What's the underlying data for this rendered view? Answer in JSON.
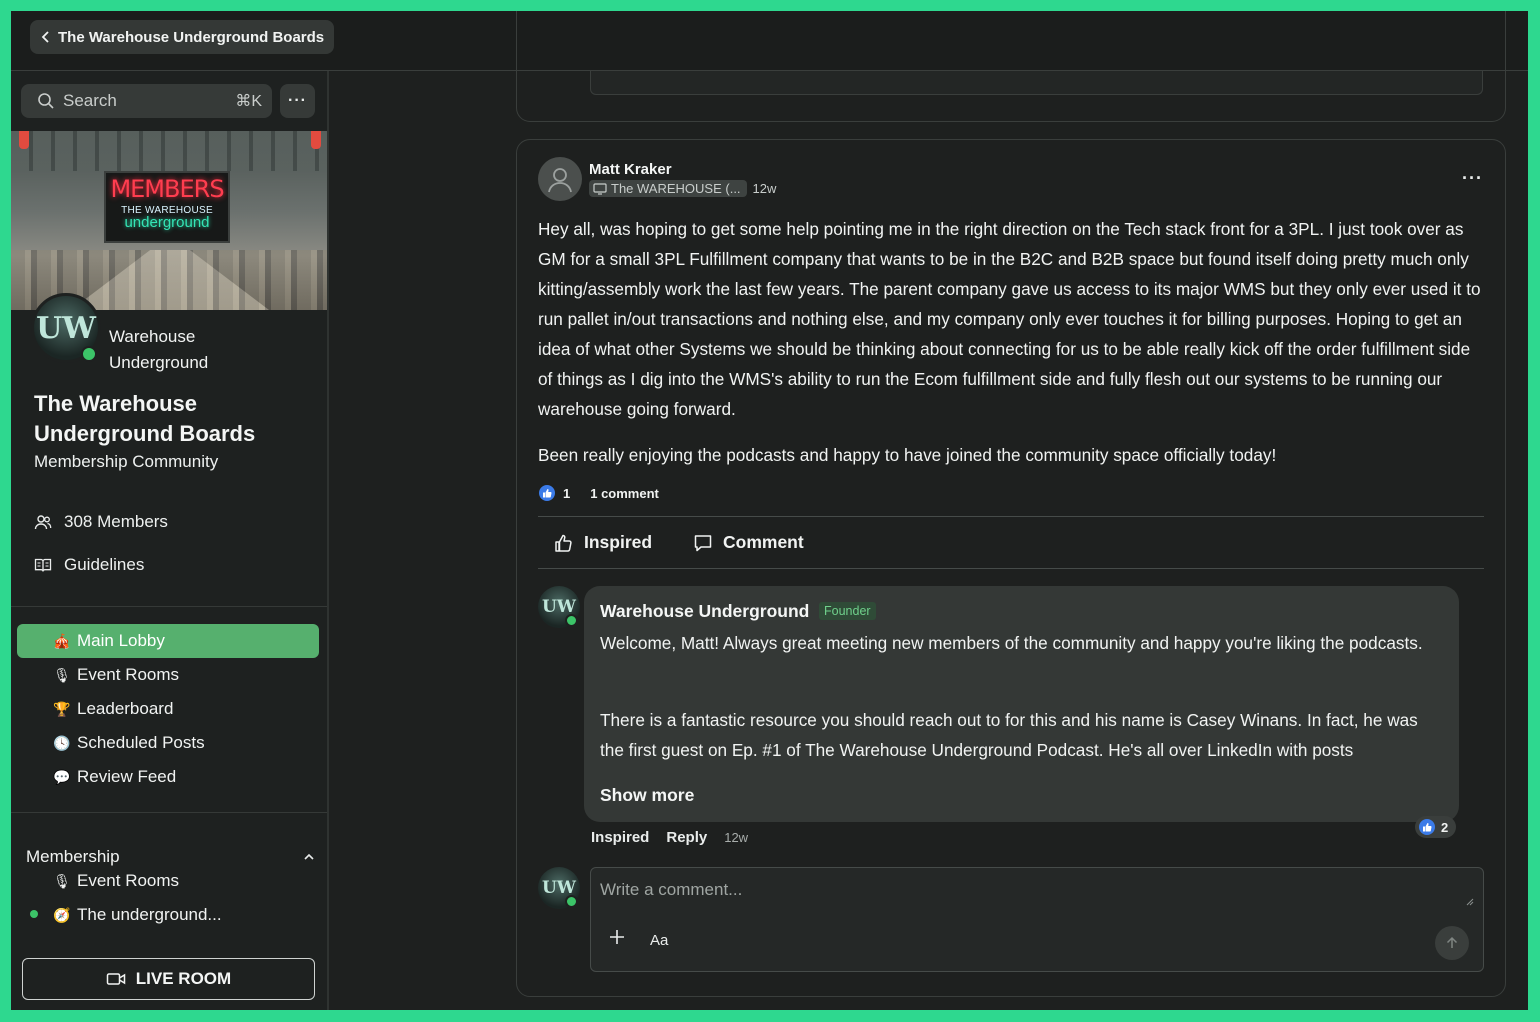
{
  "header": {
    "back_label": "The Warehouse Underground Boards"
  },
  "sidebar": {
    "search_placeholder": "Search",
    "search_shortcut": "⌘K",
    "more_label": "···",
    "banner": {
      "sign_top": "MEMBERS",
      "sign_mid": "THE WAREHOUSE",
      "sign_bottom": "underground"
    },
    "community_avatar_text": "UW",
    "community_name_line1": "Warehouse",
    "community_name_line2": "Underground",
    "board_title_line1": "The Warehouse",
    "board_title_line2": "Underground Boards",
    "board_subtitle": "Membership Community",
    "members_label": "308 Members",
    "guidelines_label": "Guidelines",
    "nav": [
      {
        "emoji": "🎪",
        "label": "Main Lobby"
      },
      {
        "emoji": "🎙",
        "label": "Event Rooms"
      },
      {
        "emoji": "🏆",
        "label": "Leaderboard"
      },
      {
        "emoji": "🕓",
        "label": "Scheduled Posts"
      },
      {
        "emoji": "💬",
        "label": "Review Feed"
      }
    ],
    "membership_section": "Membership",
    "membership_items": [
      {
        "emoji": "🎙",
        "label": "Event Rooms"
      },
      {
        "emoji": "🧭",
        "label": "The underground..."
      }
    ],
    "live_room_label": "LIVE ROOM"
  },
  "post": {
    "author": "Matt Kraker",
    "space_chip": "The WAREHOUSE (...",
    "time": "12w",
    "more": "···",
    "paragraph1": "Hey all, was hoping to get some help pointing me in the right direction on the Tech stack front for a 3PL. I just took over as GM for a small 3PL Fulfillment company that wants to be in the B2C and B2B space but found itself doing pretty much only kitting/assembly work the last few years. The parent company gave us access to its major WMS but they only ever used it to run pallet in/out transactions and nothing else, and my company only ever touches it for billing purposes. Hoping to get an idea of what other Systems we should be thinking about connecting for us to be able really kick off the order fulfillment side of things as I dig into the WMS's ability to run the Ecom fulfillment side and fully flesh out our systems to be running our warehouse going forward.",
    "paragraph2": "Been really enjoying the podcasts and happy to have joined the community space officially today!",
    "like_count": "1",
    "comment_count": "1 comment",
    "inspired_label": "Inspired",
    "comment_label": "Comment"
  },
  "comment": {
    "author": "Warehouse Underground",
    "badge": "Founder",
    "p1": "Welcome, Matt! Always great meeting new members of the community and happy you're liking the podcasts.",
    "p2": "There is a fantastic resource you should reach out to for this and his name is Casey Winans. In fact, he was the first guest on Ep. #1 of The Warehouse Underground Podcast. He's all over LinkedIn with posts",
    "show_more": "Show more",
    "inspired": "Inspired",
    "reply": "Reply",
    "time": "12w",
    "like_count": "2"
  },
  "composer": {
    "placeholder": "Write a comment...",
    "format_label": "Aa"
  },
  "colors": {
    "accent": "#56b06e",
    "frame": "#2ed88f",
    "like": "#3b7be8",
    "online": "#3cc468"
  }
}
